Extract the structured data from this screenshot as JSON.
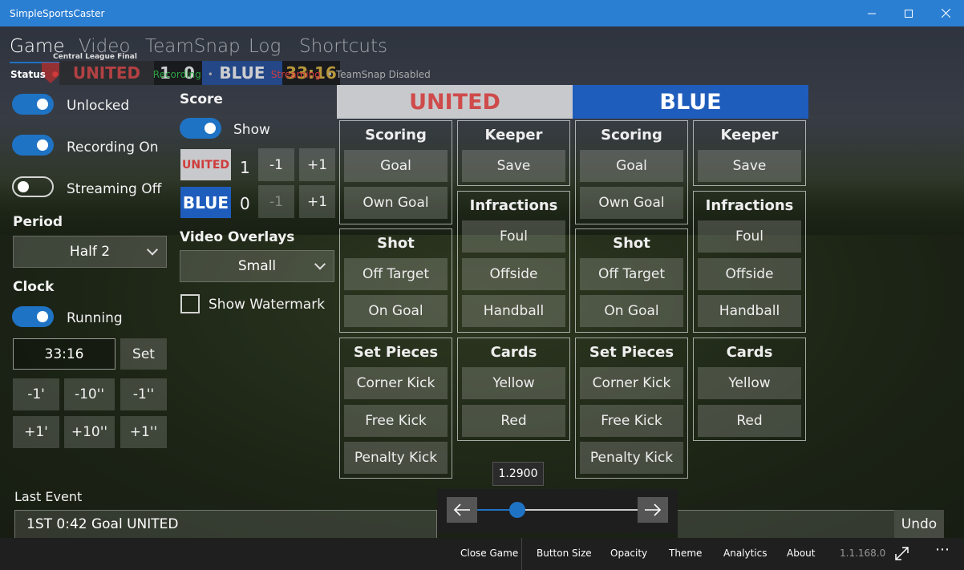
{
  "window": {
    "title": "SimpleSportsCaster"
  },
  "nav": {
    "tabs": [
      "Game",
      "Video",
      "TeamSnap",
      "Log",
      "Shortcuts"
    ],
    "active": "Game"
  },
  "scorebug": {
    "caption": "Central League Final",
    "home_name": "UNITED",
    "home_score": "1",
    "away_score": "0",
    "away_name": "BLUE",
    "clock": "33:16"
  },
  "status": {
    "label": "Status",
    "items": [
      "Recording",
      "Streaming",
      "TeamSnap Disabled"
    ]
  },
  "toggles": {
    "lock": "Unlocked",
    "recording": "Recording On",
    "streaming": "Streaming Off"
  },
  "period": {
    "label": "Period",
    "value": "Half 2"
  },
  "clock": {
    "label": "Clock",
    "toggle": "Running",
    "value": "33:16",
    "set": "Set",
    "adjust_minus": [
      "-1'",
      "-10''",
      "-1''"
    ],
    "adjust_plus": [
      "+1'",
      "+10''",
      "+1''"
    ]
  },
  "score": {
    "label": "Score",
    "show": "Show",
    "home": {
      "name": "UNITED",
      "value": "1",
      "minus": "-1",
      "plus": "+1"
    },
    "away": {
      "name": "BLUE",
      "value": "0",
      "minus": "-1",
      "plus": "+1"
    }
  },
  "overlays": {
    "label": "Video Overlays",
    "value": "Small",
    "watermark": "Show Watermark"
  },
  "teams": {
    "home": {
      "name": "UNITED",
      "color": "#cf4b4b",
      "bg": "#c8c9cc"
    },
    "away": {
      "name": "BLUE",
      "color": "#ffffff",
      "bg": "#1f5dbd"
    }
  },
  "panel": {
    "scoring": {
      "title": "Scoring",
      "buttons": [
        "Goal",
        "Own Goal"
      ]
    },
    "keeper": {
      "title": "Keeper",
      "buttons": [
        "Save"
      ]
    },
    "shot": {
      "title": "Shot",
      "buttons": [
        "Off Target",
        "On Goal"
      ]
    },
    "infractions": {
      "title": "Infractions",
      "buttons": [
        "Foul",
        "Offside",
        "Handball"
      ]
    },
    "setpieces": {
      "title": "Set Pieces",
      "buttons": [
        "Corner Kick",
        "Free Kick",
        "Penalty Kick"
      ]
    },
    "cards": {
      "title": "Cards",
      "buttons": [
        "Yellow",
        "Red"
      ]
    }
  },
  "slider": {
    "value_label": "1.2900",
    "value_fraction": 0.25
  },
  "last_event": {
    "label": "Last Event",
    "value": "1ST 0:42 Goal UNITED",
    "undo": "Undo"
  },
  "bottom": {
    "items": [
      "Close Game",
      "Button Size",
      "Opacity",
      "Theme",
      "Analytics",
      "About"
    ],
    "version": "1.1.168.0"
  },
  "colors": {
    "accent": "#1f73c4",
    "titlebar": "#2b7fd3",
    "recording": "#2ea043",
    "streaming": "#d13b3b"
  }
}
